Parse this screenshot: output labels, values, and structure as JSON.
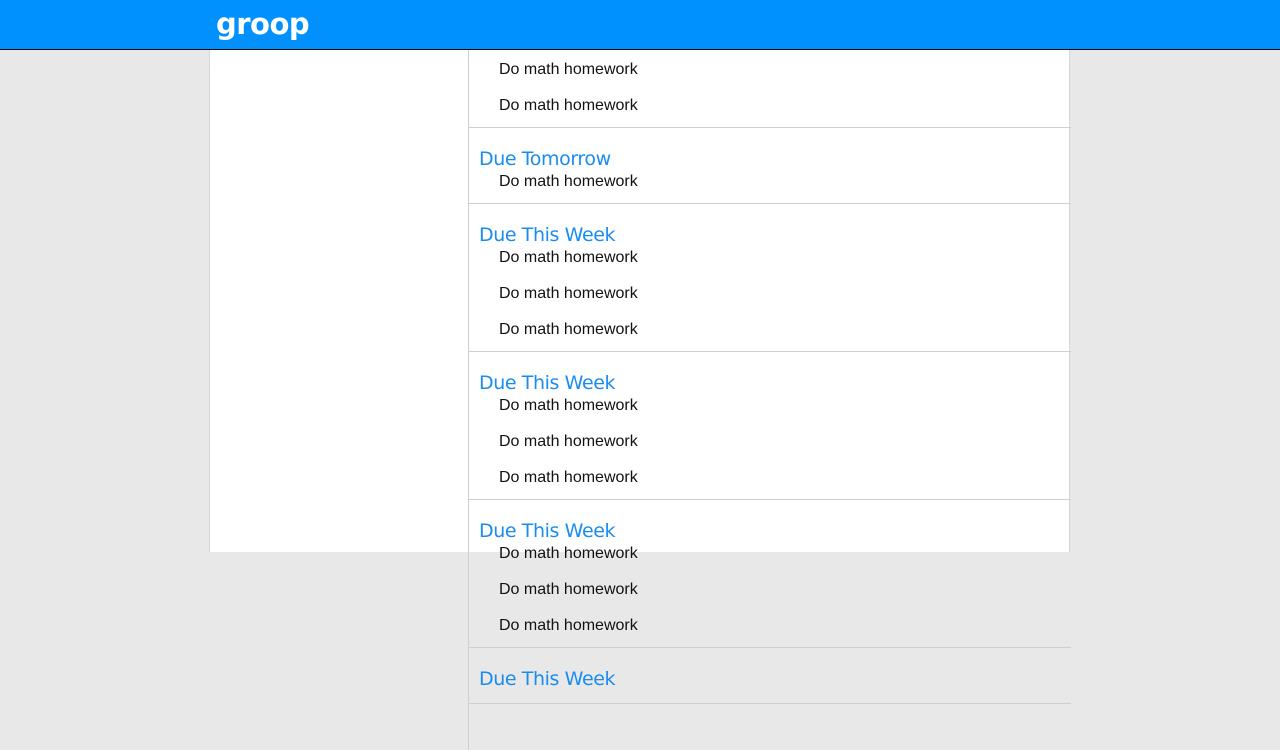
{
  "app": {
    "logo_text": "groop",
    "brand_color": "#0091ff",
    "accent_color": "#1a8cf0"
  },
  "task_groups": [
    {
      "title": "",
      "tasks": [
        "Do math homework",
        "Do math homework"
      ]
    },
    {
      "title": "Due Tomorrow",
      "tasks": [
        "Do math homework"
      ]
    },
    {
      "title": "Due This Week",
      "tasks": [
        "Do math homework",
        "Do math homework",
        "Do math homework"
      ]
    },
    {
      "title": "Due This Week",
      "tasks": [
        "Do math homework",
        "Do math homework",
        "Do math homework"
      ]
    },
    {
      "title": "Due This Week",
      "tasks": [
        "Do math homework",
        "Do math homework",
        "Do math homework"
      ]
    },
    {
      "title": "Due This Week",
      "tasks": []
    }
  ]
}
